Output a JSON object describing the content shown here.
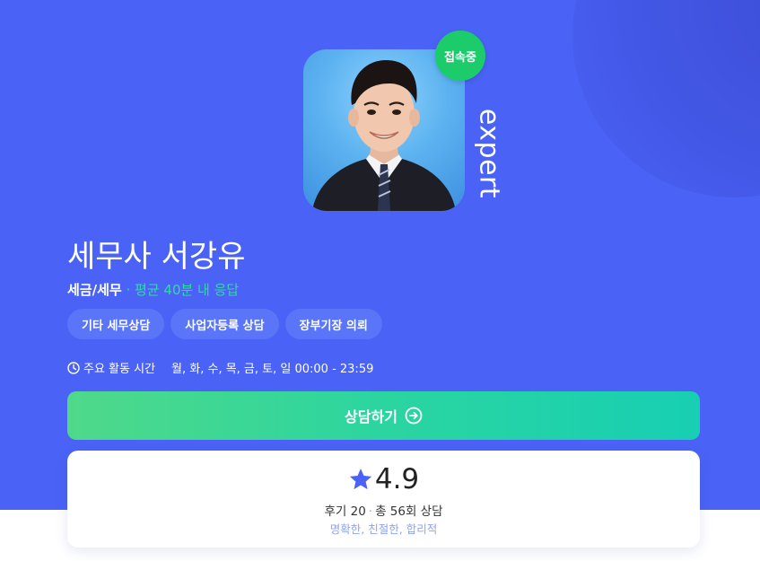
{
  "profile": {
    "status_badge": "접속중",
    "expert_word": "expert",
    "name": "세무사 서강유",
    "category": "세금/세무",
    "separator": "·",
    "response_time": "평균 40분 내 응답"
  },
  "tags": [
    "기타 세무상담",
    "사업자등록 상담",
    "장부기장 의뢰"
  ],
  "hours": {
    "label": "주요 활동 시간",
    "value": "월, 화, 수, 목, 금, 토, 일 00:00 - 23:59"
  },
  "cta": {
    "label": "상담하기"
  },
  "rating": {
    "score": "4.9",
    "reviews": "후기 20",
    "sessions": "총 56회 상담",
    "keywords": "명확한, 친절한, 합리적"
  },
  "colors": {
    "hero_bg": "#4a63f6",
    "status_green": "#1ccc6b",
    "cta_start": "#4fd98a",
    "cta_end": "#17cfb3",
    "star": "#4a63f6",
    "response_accent": "#33d9a6"
  },
  "icons": {
    "clock": "clock-icon",
    "arrow": "arrow-circle-right-icon",
    "star": "star-icon"
  }
}
